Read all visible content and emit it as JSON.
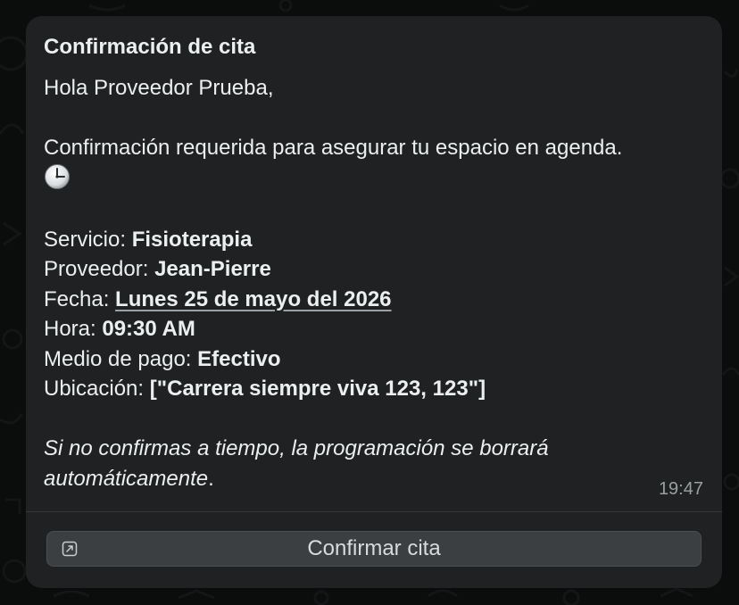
{
  "message": {
    "title": "Confirmación de cita",
    "greeting": "Hola Proveedor Prueba,",
    "intro": "Confirmación requerida para asegurar tu espacio en agenda.",
    "intro_emoji": "clock-icon",
    "fields": {
      "service_label": "Servicio: ",
      "service_value": "Fisioterapia",
      "provider_label": "Proveedor: ",
      "provider_value": "Jean-Pierre",
      "date_label": "Fecha: ",
      "date_value": "Lunes 25 de mayo del 2026",
      "time_label": "Hora: ",
      "time_value": "09:30 AM",
      "payment_label": "Medio de pago: ",
      "payment_value": "Efectivo",
      "location_label": "Ubicación: ",
      "location_value": "[\"Carrera siempre viva 123, 123\"]"
    },
    "warning_line1": "Si no confirmas a tiempo, la programación se borrará",
    "warning_line2_italic": "automáticamente",
    "warning_line2_end": ".",
    "timestamp": "19:47"
  },
  "action": {
    "label": "Confirmar cita",
    "icon": "external-link-icon"
  },
  "colors": {
    "background": "#0b0c0c",
    "bubble": "#1f2122",
    "button": "#3b3f41",
    "text": "#e9edef",
    "muted": "#9aa0a2"
  }
}
